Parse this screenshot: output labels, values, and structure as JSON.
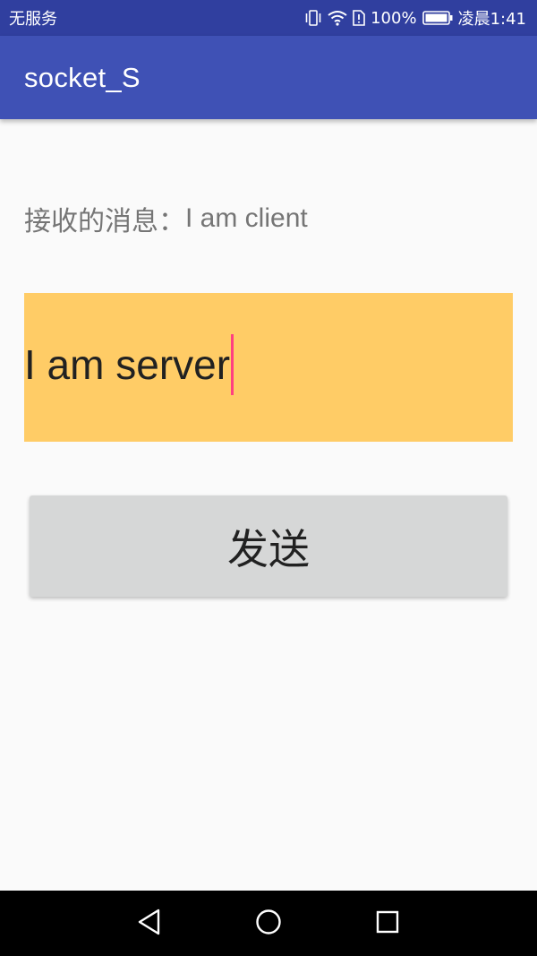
{
  "status_bar": {
    "carrier": "无服务",
    "battery_percent": "100%",
    "time": "凌晨1:41",
    "icons": [
      "vibrate-icon",
      "wifi-icon",
      "sim-icon",
      "battery-icon"
    ]
  },
  "app_bar": {
    "title": "socket_S"
  },
  "main": {
    "received_label": "接收的消息：",
    "received_message": "I am client",
    "input_value": "I am server",
    "send_label": "发送"
  },
  "nav_bar": {
    "icons": [
      "back-icon",
      "home-icon",
      "recents-icon"
    ]
  },
  "colors": {
    "status_bar": "#303f9f",
    "app_bar": "#3f51b5",
    "input_background": "#ffcc66",
    "cursor": "#ff4081",
    "button": "#d6d7d7",
    "nav_bar": "#000000"
  }
}
